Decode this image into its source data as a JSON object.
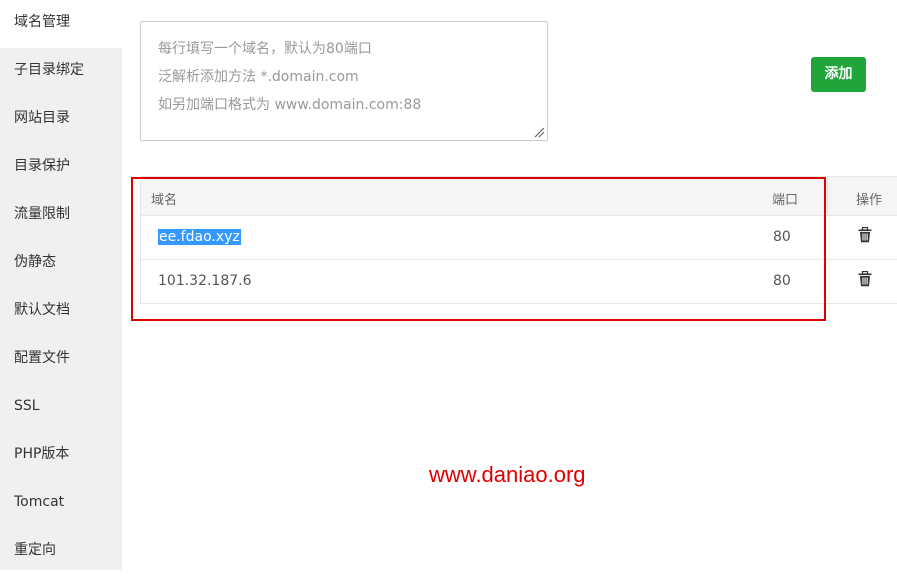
{
  "sidebar": {
    "items": [
      {
        "label": "域名管理",
        "active": true
      },
      {
        "label": "子目录绑定"
      },
      {
        "label": "网站目录"
      },
      {
        "label": "目录保护"
      },
      {
        "label": "流量限制"
      },
      {
        "label": "伪静态"
      },
      {
        "label": "默认文档"
      },
      {
        "label": "配置文件"
      },
      {
        "label": "SSL"
      },
      {
        "label": "PHP版本"
      },
      {
        "label": "Tomcat"
      },
      {
        "label": "重定向"
      }
    ]
  },
  "domain_input": {
    "placeholder_lines": [
      "每行填写一个域名，默认为80端口",
      "泛解析添加方法 *.domain.com",
      "如另加端口格式为 www.domain.com:88"
    ],
    "value": ""
  },
  "add_button": {
    "label": "添加",
    "color": "#20a53a"
  },
  "table": {
    "headers": {
      "domain": "域名",
      "port": "端口",
      "action": "操作"
    },
    "rows": [
      {
        "domain": "ee.fdao.xyz",
        "port": "80",
        "selected": true,
        "action_icon": "trash-icon"
      },
      {
        "domain": "101.32.187.6",
        "port": "80",
        "selected": false,
        "action_icon": "trash-icon"
      }
    ]
  },
  "annotation": {
    "highlight_color": "#e10000"
  },
  "watermark": {
    "text": "www.daniao.org",
    "color": "#e10000"
  }
}
